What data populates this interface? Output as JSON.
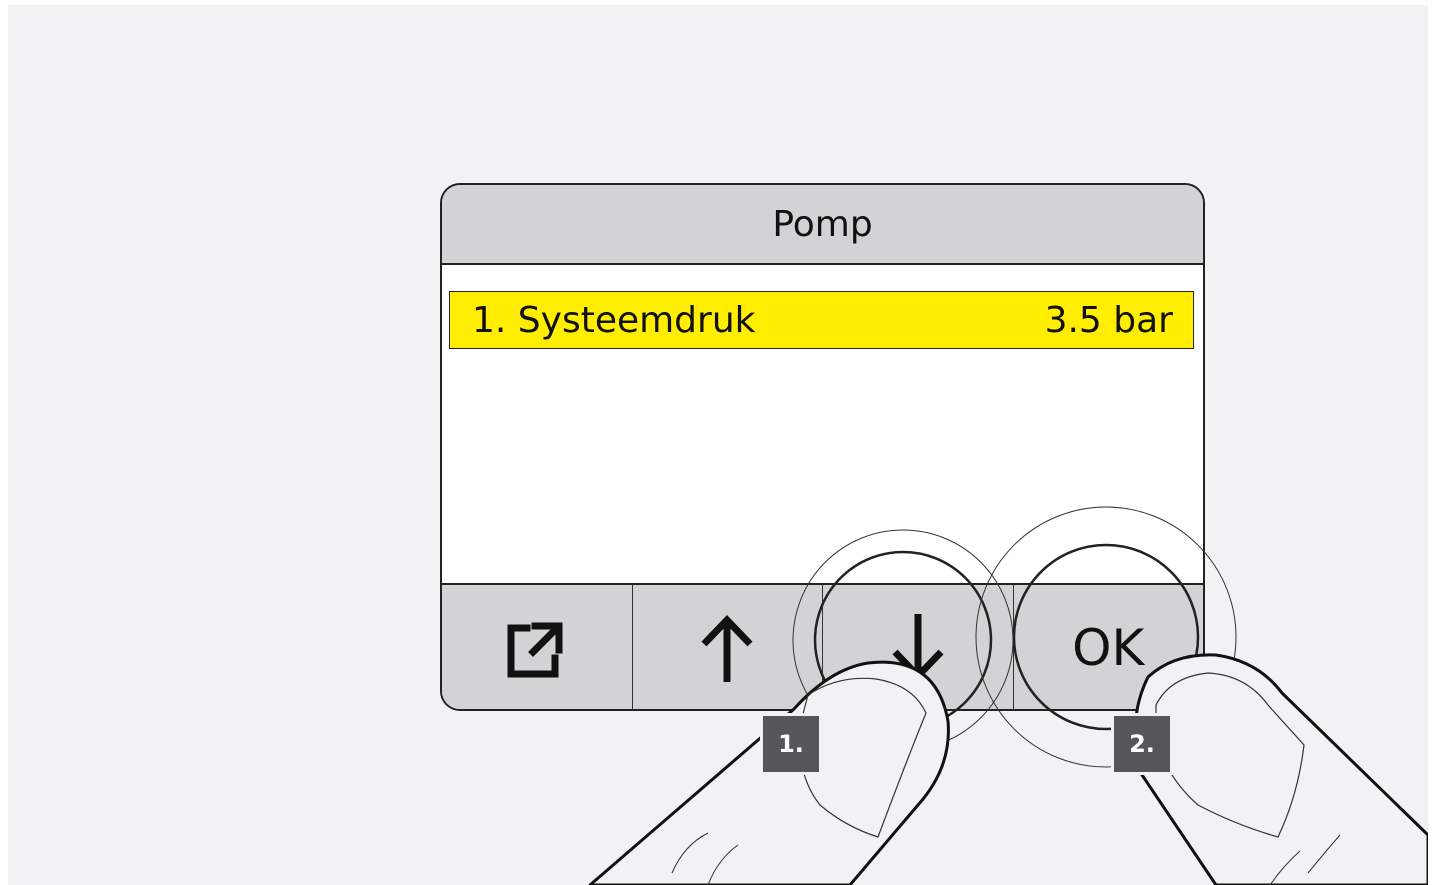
{
  "screen": {
    "title": "Pomp",
    "menu_item": {
      "label": "1. Systeemdruk",
      "value": "3.5 bar",
      "highlight_color": "#ffee00"
    },
    "softkeys": [
      {
        "icon": "export-icon"
      },
      {
        "icon": "arrow-up-icon"
      },
      {
        "icon": "arrow-down-icon"
      },
      {
        "label": "OK"
      }
    ]
  },
  "steps": [
    {
      "label": "1."
    },
    {
      "label": "2."
    }
  ],
  "colors": {
    "background": "#f1f2f4",
    "panel_gray": "#d2d3d5",
    "badge": "#555659"
  }
}
